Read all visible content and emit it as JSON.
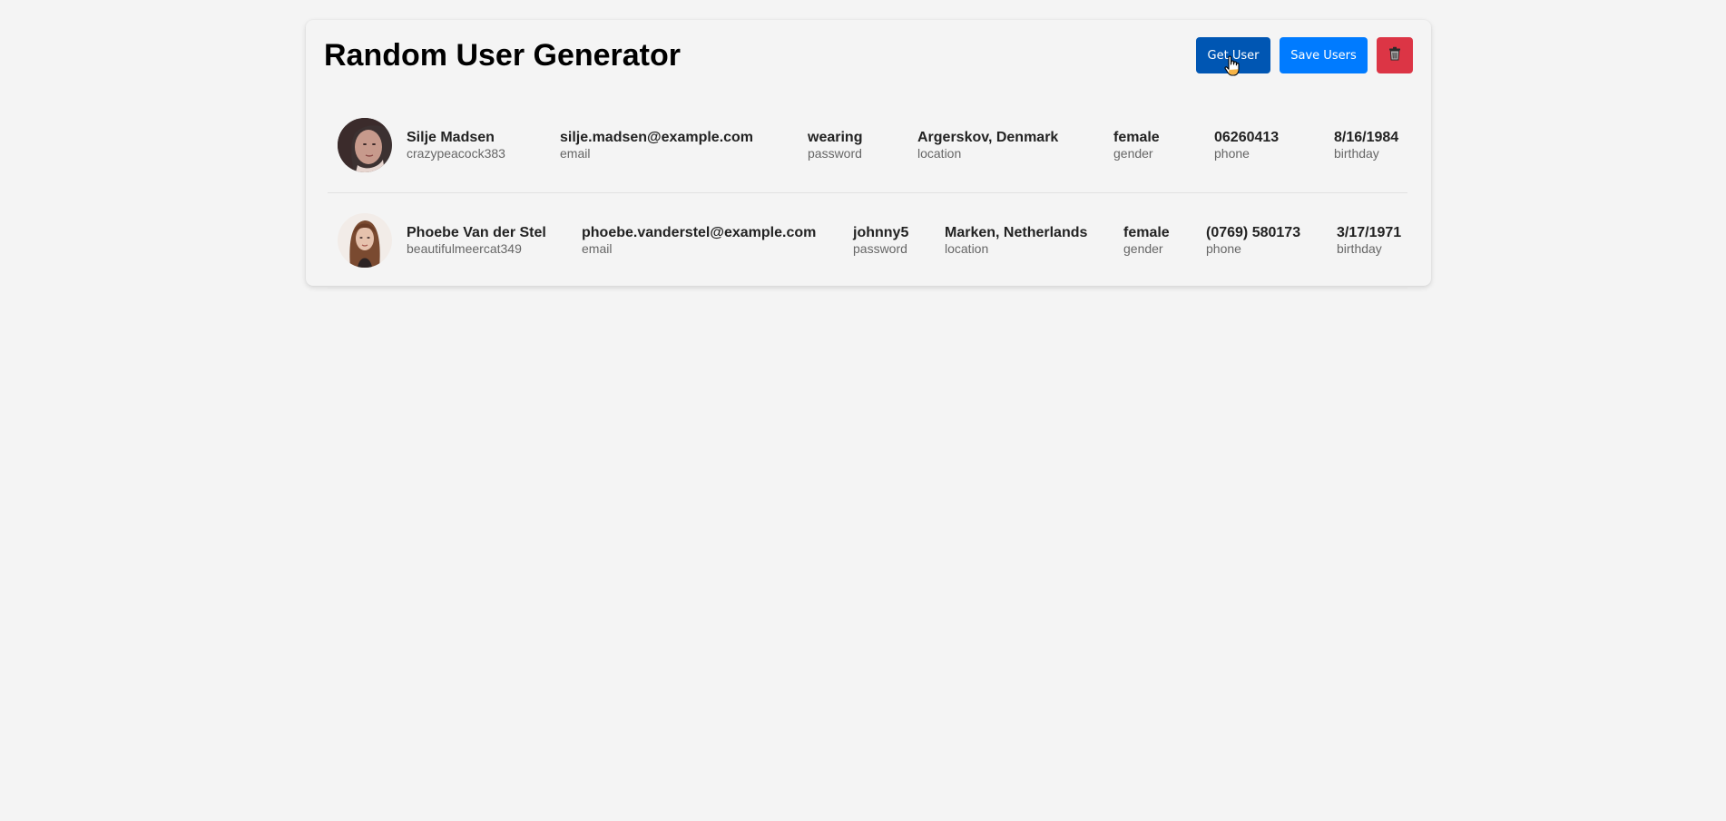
{
  "app": {
    "title": "Random User Generator"
  },
  "toolbar": {
    "get_label": "Get User",
    "save_label": "Save Users",
    "delete_icon": "trash-icon",
    "colors": {
      "get": "#0056b3",
      "save": "#007bff",
      "delete": "#dc3545"
    }
  },
  "users": [
    {
      "name": "Silje Madsen",
      "username": "crazypeacock383",
      "email": "silje.madsen@example.com",
      "email_label": "email",
      "password": "wearing",
      "password_label": "password",
      "location": "Argerskov, Denmark",
      "location_label": "location",
      "gender": "female",
      "gender_label": "gender",
      "phone": "06260413",
      "phone_label": "phone",
      "birthday": "8/16/1984",
      "birthday_label": "birthday"
    },
    {
      "name": "Phoebe Van der Stel",
      "username": "beautifulmeercat349",
      "email": "phoebe.vanderstel@example.com",
      "email_label": "email",
      "password": "johnny5",
      "password_label": "password",
      "location": "Marken, Netherlands",
      "location_label": "location",
      "gender": "female",
      "gender_label": "gender",
      "phone": "(0769) 580173",
      "phone_label": "phone",
      "birthday": "3/17/1971",
      "birthday_label": "birthday"
    }
  ]
}
